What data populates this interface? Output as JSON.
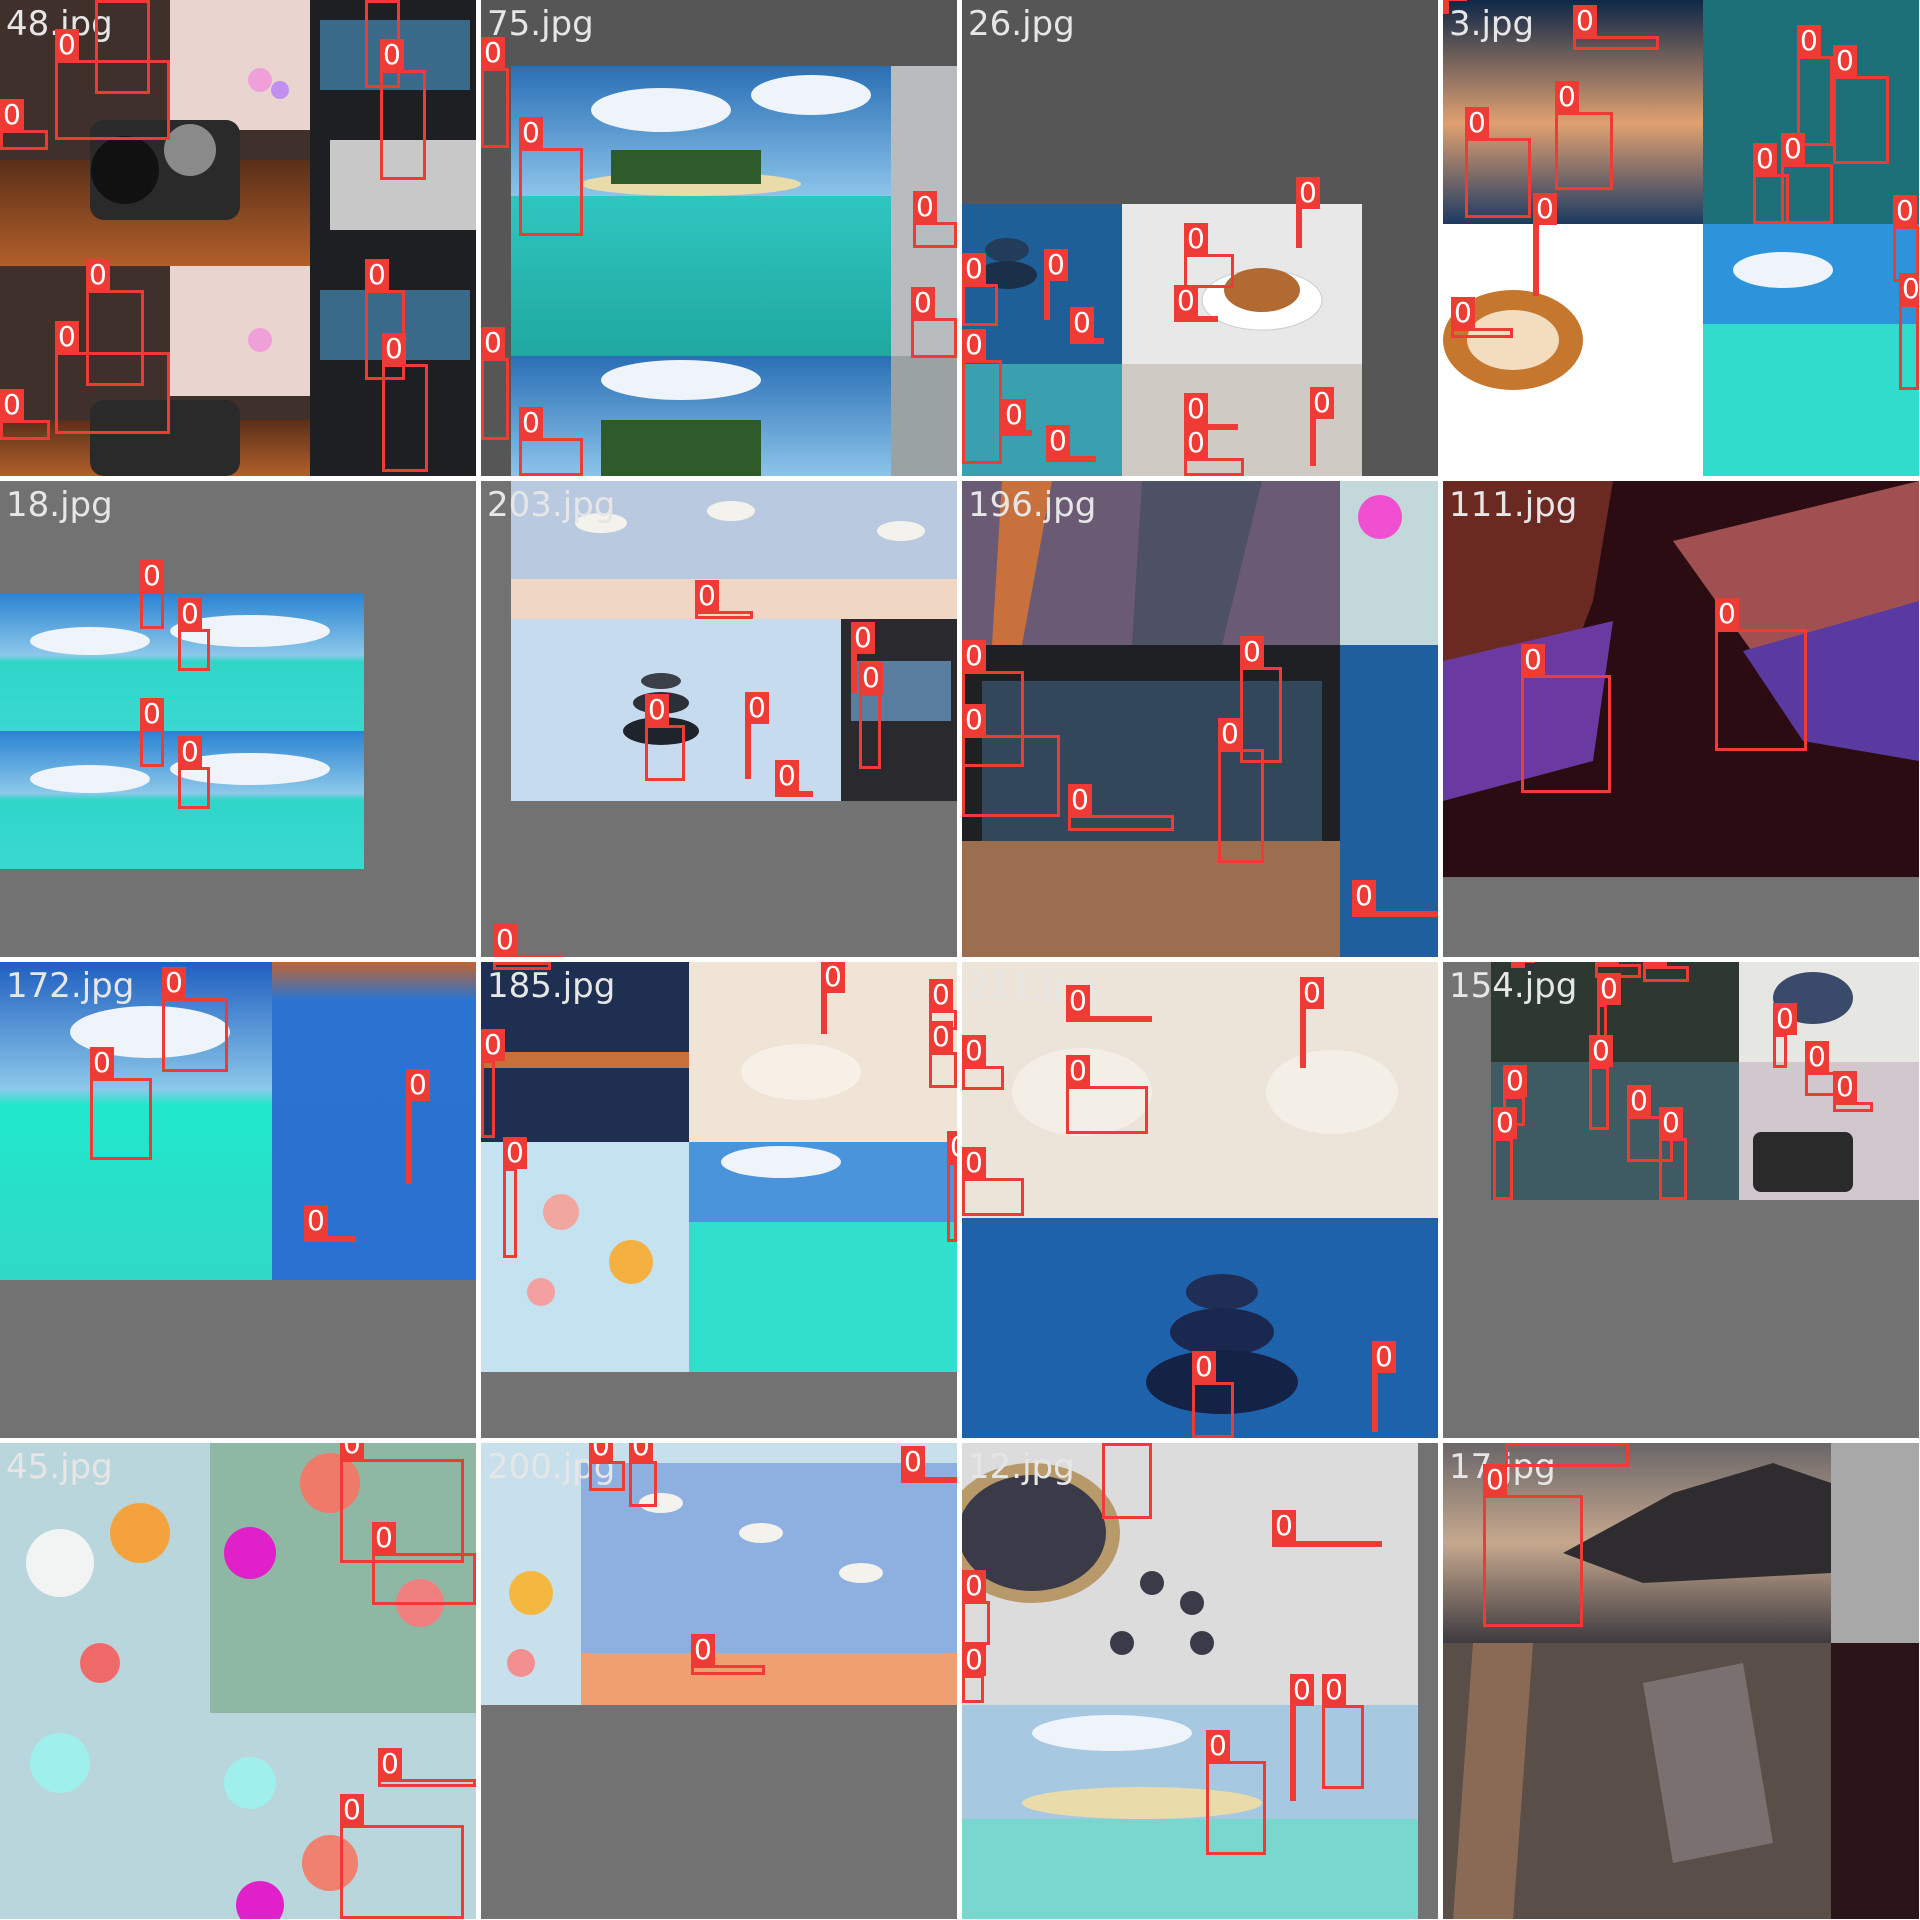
{
  "colors": {
    "box": "#ef3b35",
    "padding_gray": "#727272",
    "label_text": "#ffffff",
    "filename_text": "#e6e6e6"
  },
  "tiles": [
    {
      "name": "48.jpg",
      "scene": "camera-desk",
      "label_count": 12
    },
    {
      "name": "75.jpg",
      "scene": "tropical-island",
      "label_count": 9
    },
    {
      "name": "26.jpg",
      "scene": "coffee-and-stones",
      "label_count": 14
    },
    {
      "name": "3.jpg",
      "scene": "sunset-ocean-coffee",
      "label_count": 14
    },
    {
      "name": "18.jpg",
      "scene": "island-repeat",
      "label_count": 6
    },
    {
      "name": "203.jpg",
      "scene": "clouds-wall-stones",
      "label_count": 9
    },
    {
      "name": "196.jpg",
      "scene": "canyon-laptop",
      "label_count": 10
    },
    {
      "name": "111.jpg",
      "scene": "antelope-canyon",
      "label_count": 2
    },
    {
      "name": "172.jpg",
      "scene": "island-blue",
      "label_count": 6
    },
    {
      "name": "185.jpg",
      "scene": "chairs-bokeh-island",
      "label_count": 9
    },
    {
      "name": "211.jpg",
      "scene": "chairs-stones",
      "label_count": 8
    },
    {
      "name": "154.jpg",
      "scene": "plums-rain-camera",
      "label_count": 20
    },
    {
      "name": "45.jpg",
      "scene": "bokeh",
      "label_count": 5
    },
    {
      "name": "200.jpg",
      "scene": "clouds-wall",
      "label_count": 5
    },
    {
      "name": "12.jpg",
      "scene": "plums-island",
      "label_count": 10
    },
    {
      "name": "17.jpg",
      "scene": "mountain-canyon",
      "label_count": 2
    }
  ],
  "box_label": "0"
}
